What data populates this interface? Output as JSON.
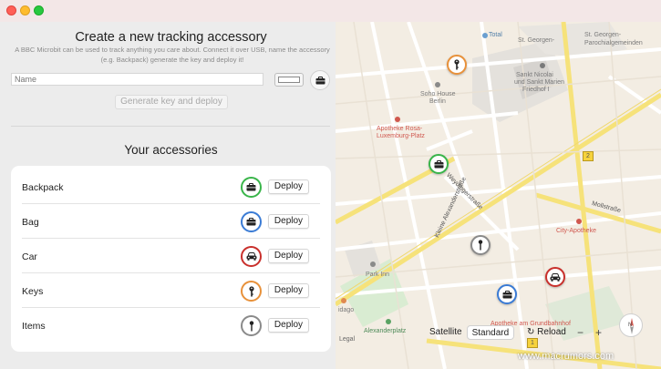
{
  "window": {
    "title": ""
  },
  "create": {
    "heading": "Create a new tracking accessory",
    "description": "A BBC Microbit can be used to track anything you care about. Connect it over USB, name the accessory (e.g. Backpack) generate the key and deploy it!",
    "name_placeholder": "Name",
    "generate_label": "Generate key and deploy"
  },
  "accessories": {
    "heading": "Your accessories",
    "deploy_label": "Deploy",
    "items": [
      {
        "label": "Backpack",
        "icon": "briefcase-icon",
        "color": "#39b54a"
      },
      {
        "label": "Bag",
        "icon": "briefcase-icon",
        "color": "#3a7bd5"
      },
      {
        "label": "Car",
        "icon": "car-icon",
        "color": "#c9302c"
      },
      {
        "label": "Keys",
        "icon": "key-icon",
        "color": "#e8913a"
      },
      {
        "label": "Items",
        "icon": "pin-icon",
        "color": "#8a8a8a"
      }
    ]
  },
  "map": {
    "labels": {
      "total": "Total",
      "stgeorgen": "St. Georgen-",
      "parochial": "Parochialgemeinden",
      "sanktnicolai": "Sankt Nicolai",
      "sanktmarien": "und Sankt Marien",
      "friedhof": "Friedhof I",
      "soho": "Soho House",
      "berlin": "Berlin",
      "apotheke_rosa": "Apotheke Rosa-",
      "luxemburg": "Luxemburg-Platz",
      "weydingerstr": "Weydingerstraße",
      "kleinstr": "Kleine Alexanderstraße",
      "mollstrasse": "Mollstraße",
      "cityapotheke": "City-Apotheke",
      "parkinn": "Park Inn",
      "alexanderplatz": "Alexanderplatz",
      "apotheke_grund": "Apotheke am Grundbahnhof",
      "idago": "idago",
      "road2": "2",
      "road1": "1"
    },
    "satellite_label": "Satellite",
    "standard_label": "Standard",
    "reload_label": "Reload",
    "zoom_out": "−",
    "zoom_in": "+",
    "compass_label": "N",
    "legal": "Legal"
  },
  "watermark": "www.macrumors.com"
}
